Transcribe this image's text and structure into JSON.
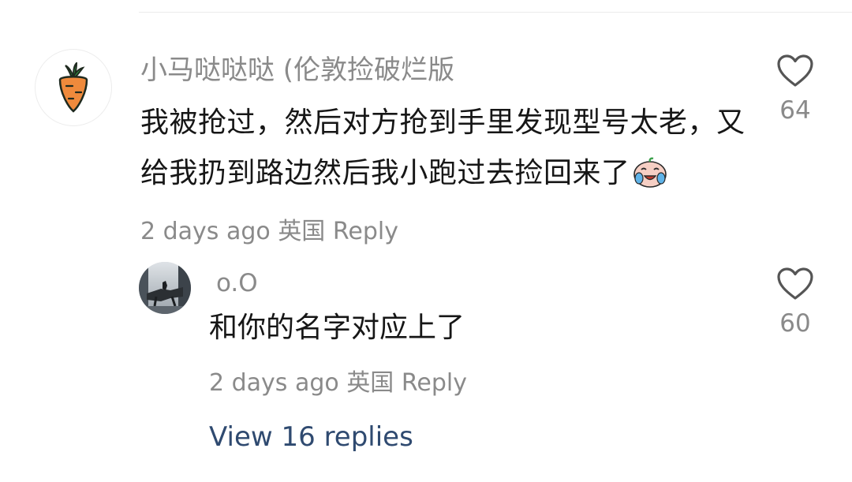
{
  "comment": {
    "username": "小马哒哒哒 (伦敦捡破烂版",
    "text": "我被抢过，然后对方抢到手里发现型号太老，又给我扔到路边然后我小跑过去捡回来了",
    "emoji_name": "crying-face-emoji",
    "time": "2 days ago",
    "location": "英国",
    "reply_label": "Reply",
    "like_count": "64",
    "avatar_icon": "carrot-icon"
  },
  "reply": {
    "username": "o.O",
    "text": "和你的名字对应上了",
    "time": "2 days ago",
    "location": "英国",
    "reply_label": "Reply",
    "like_count": "60"
  },
  "view_replies_label": "View 16 replies",
  "colors": {
    "text": "#161616",
    "muted": "#8a8a8a",
    "link": "#2f4a70",
    "carrot": "#ef8a3c",
    "leaf": "#35a04a"
  }
}
